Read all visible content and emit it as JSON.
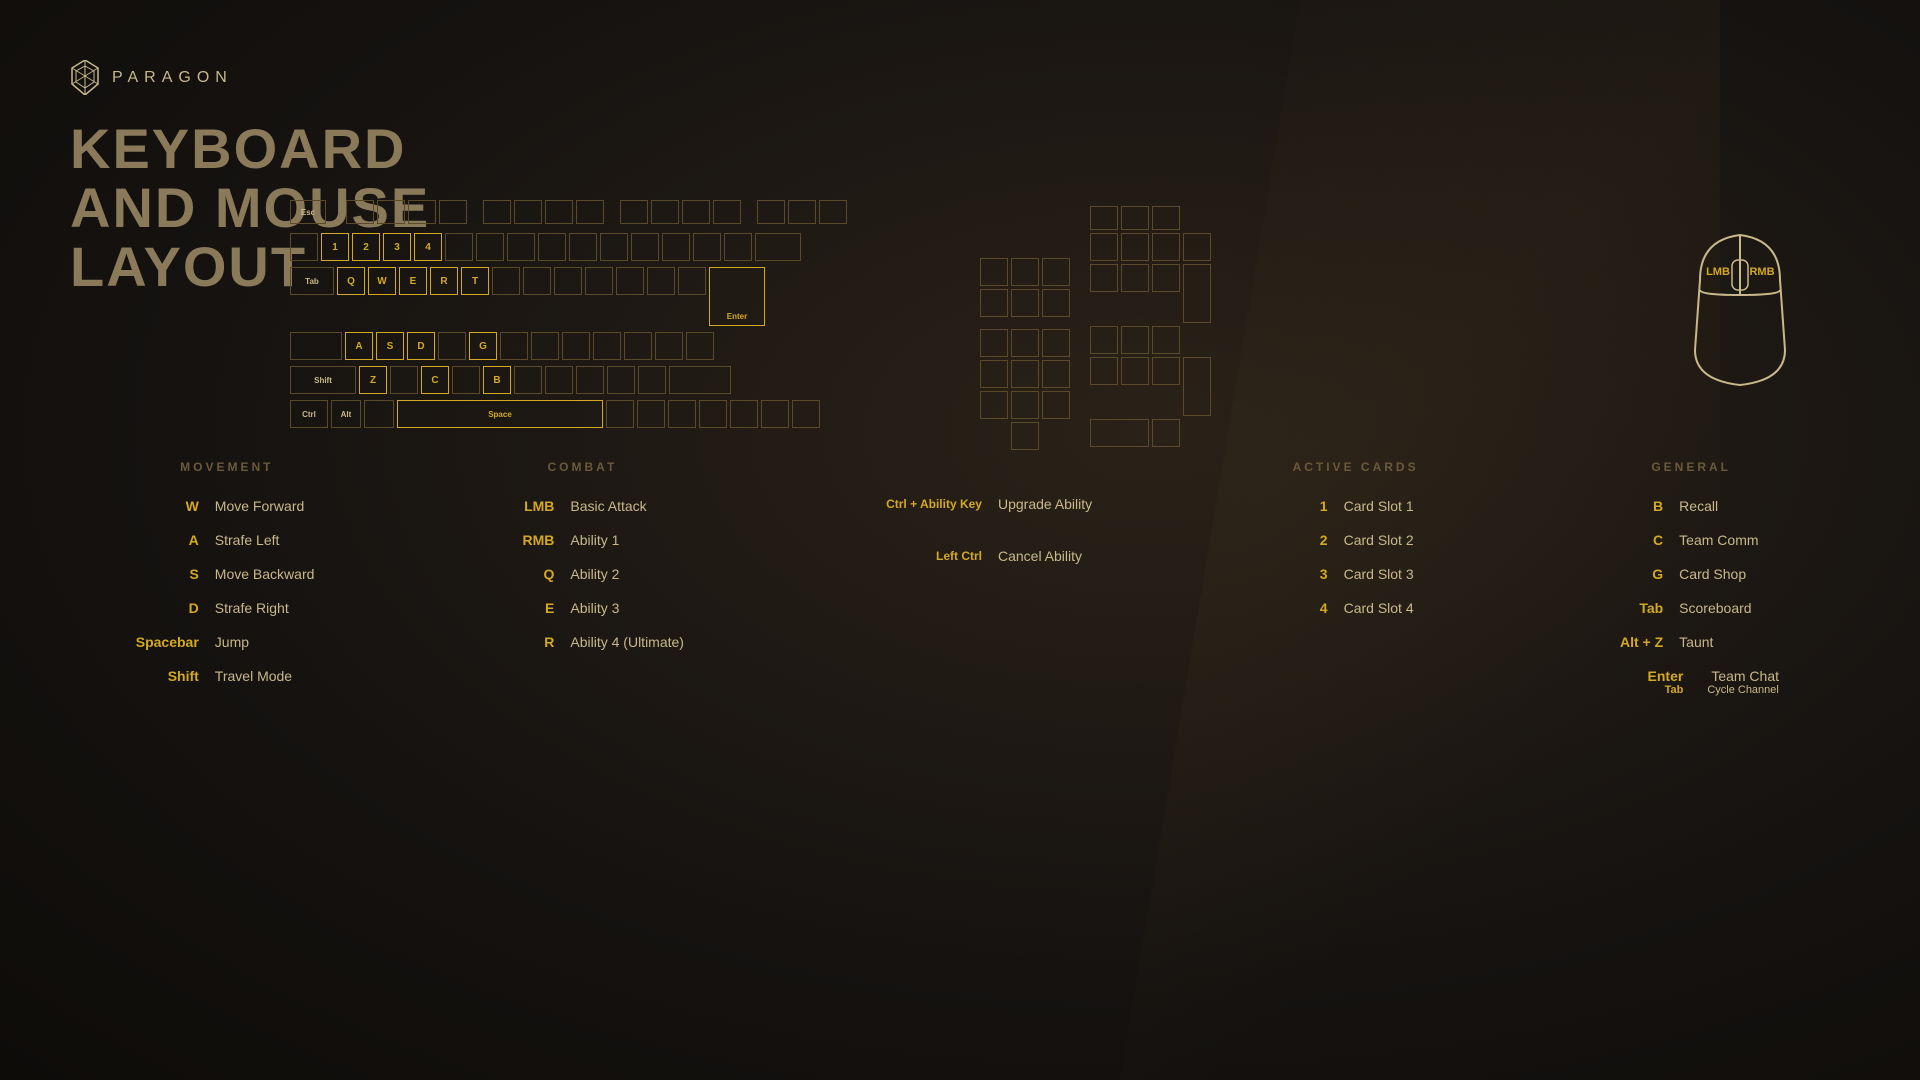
{
  "logo": {
    "text": "PARAGON"
  },
  "title": {
    "line1": "KEYBOARD",
    "line2": "AND MOUSE",
    "line3": "LAYOUT"
  },
  "sections": {
    "movement": {
      "title": "MOVEMENT",
      "binds": [
        {
          "key": "W",
          "action": "Move Forward"
        },
        {
          "key": "A",
          "action": "Strafe Left"
        },
        {
          "key": "S",
          "action": "Move Backward"
        },
        {
          "key": "D",
          "action": "Strafe Right"
        },
        {
          "key": "Spacebar",
          "action": "Jump"
        },
        {
          "key": "Shift",
          "action": "Travel Mode"
        }
      ]
    },
    "combat": {
      "title": "COMBAT",
      "binds": [
        {
          "key": "LMB",
          "action": "Basic Attack"
        },
        {
          "key": "RMB",
          "action": "Ability 1"
        },
        {
          "key": "Q",
          "action": "Ability 2"
        },
        {
          "key": "E",
          "action": "Ability 3"
        },
        {
          "key": "R",
          "action": "Ability 4 (Ultimate)"
        }
      ]
    },
    "abilities": {
      "binds": [
        {
          "key": "Ctrl + Ability Key",
          "action": "Upgrade Ability"
        },
        {
          "key": "Left Ctrl",
          "action": "Cancel Ability"
        }
      ]
    },
    "active_cards": {
      "title": "ACTIVE CARDS",
      "binds": [
        {
          "key": "1",
          "action": "Card Slot 1"
        },
        {
          "key": "2",
          "action": "Card Slot 2"
        },
        {
          "key": "3",
          "action": "Card Slot 3"
        },
        {
          "key": "4",
          "action": "Card Slot 4"
        }
      ]
    },
    "general": {
      "title": "GENERAL",
      "binds": [
        {
          "key": "B",
          "action": "Recall"
        },
        {
          "key": "C",
          "action": "Team Comm"
        },
        {
          "key": "G",
          "action": "Card Shop"
        },
        {
          "key": "Tab",
          "action": "Scoreboard"
        },
        {
          "key": "Alt + Z",
          "action": "Taunt"
        },
        {
          "key": "Enter",
          "action": "Team Chat",
          "subkey": "Tab",
          "subaction": "Cycle Channel"
        }
      ]
    }
  },
  "mouse": {
    "lmb": "LMB",
    "rmb": "RMB"
  }
}
